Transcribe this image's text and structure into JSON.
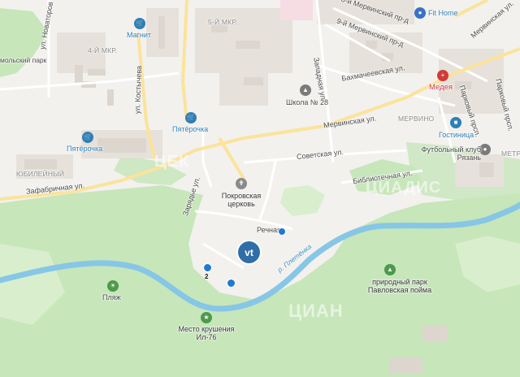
{
  "map": {
    "colors": {
      "land": "#f2f1ee",
      "forest": "#c7e6ba",
      "water": "#86c6e7",
      "road_main": "#fbe39a",
      "road": "#ffffff",
      "building": "#e2ddd6"
    },
    "labels": {
      "novatorov": "ул. Новаторов",
      "molsky_park": "мольский парк",
      "mkr4": "4-Й МКР.",
      "kostycheva": "ул. Костычева",
      "magnit": "Магнит",
      "mkr5": "5-Й МКР.",
      "pyaterochka1": "Пятёрочка",
      "pyaterochka2": "Пятёрочка",
      "yubileyny": "ЮБИЛЕЙНЫЙ",
      "zafabrichnaya": "Зафабричная ул.",
      "zaryadye": "Зарядье ул.",
      "merv_pr1": "8-й Мервинский пр-д",
      "merv_pr2": "9-й Мервинский пр-д",
      "zapadnaya": "Западная ул.",
      "merv_street_ne": "Мервинская ул.",
      "fit_home": "Fit Home",
      "bakhmacheevskaya": "Бахмачеевская ул.",
      "school": "Школа № 28",
      "medeya": "Медея",
      "parkoviy1": "Парковый прсп.",
      "parkoviy2": "Парковый прсп.",
      "mervinskaya": "Мервинская ул.",
      "mervino": "МЕРВИНО",
      "gostinitsa": "Гостиница",
      "sovetskaya": "Советская ул.",
      "futbol": "Футбольный клуб Рязань",
      "metr": "МЕТР",
      "bibliotechnaya": "Библиотечная ул.",
      "church": "Покровская церковь",
      "rechnaya": "Речная",
      "river": "р. Плетёнка",
      "park": "природный парк Павловская пойма",
      "plyazh": "Пляж",
      "crash": "Место крушения Ил-76",
      "pin_number": "2",
      "brand_vt": "vt",
      "wm1": "ЦЕК",
      "wm2": "ЦИАН",
      "wm3": "ЦИАДИС"
    }
  }
}
